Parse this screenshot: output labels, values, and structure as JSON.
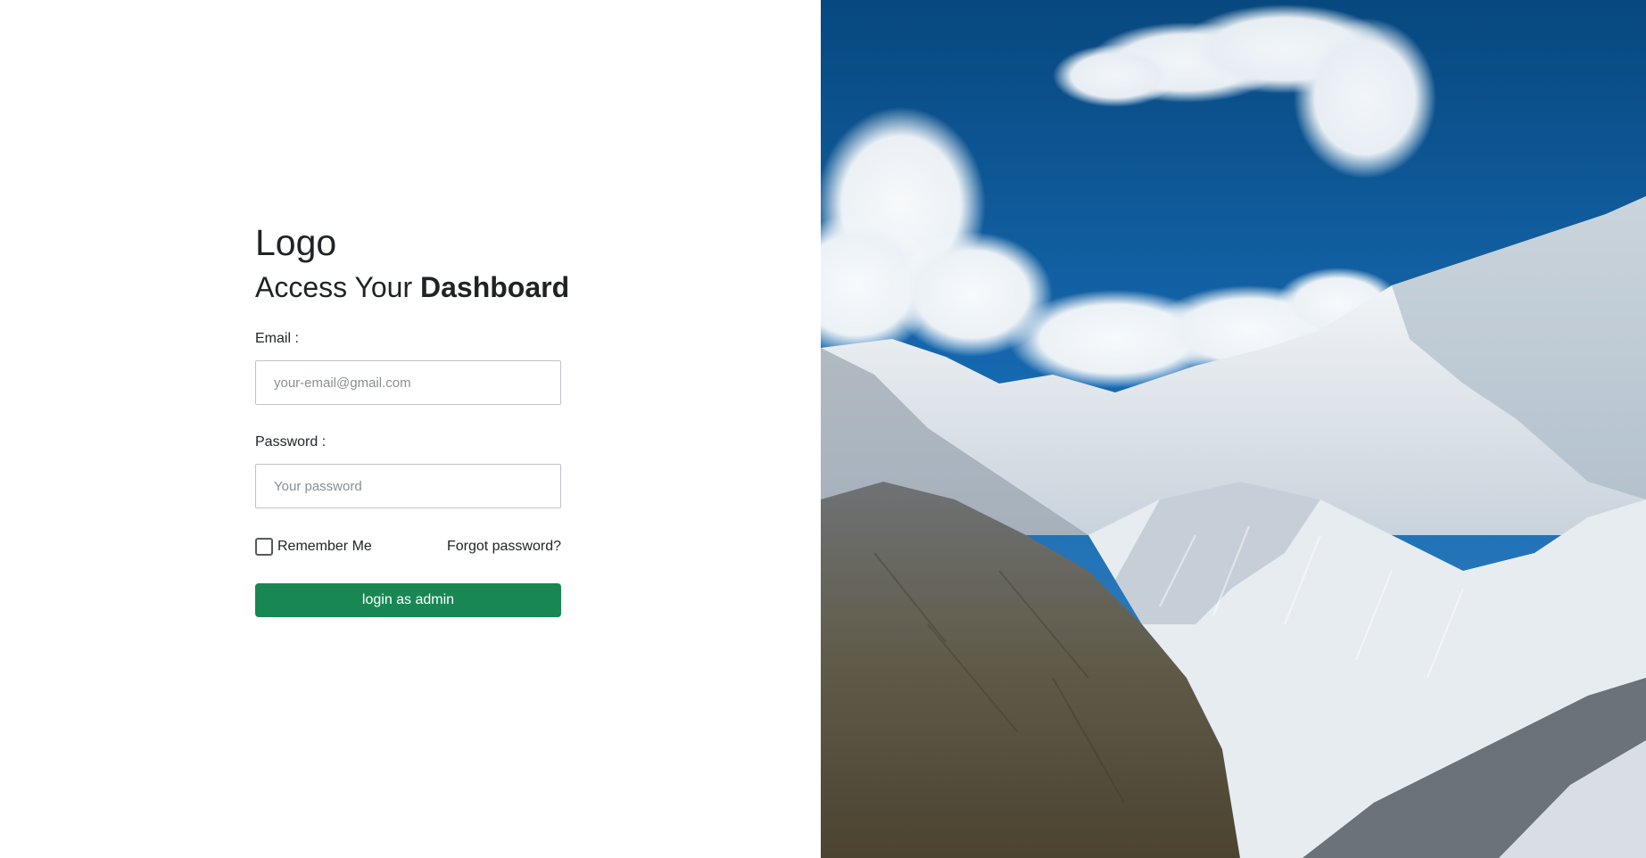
{
  "brand": {
    "logo_text": "Logo"
  },
  "heading": {
    "prefix": "Access Your ",
    "emphasis": "Dashboard"
  },
  "form": {
    "email_label": "Email :",
    "email_placeholder": "your-email@gmail.com",
    "email_value": "",
    "password_label": "Password :",
    "password_placeholder": "Your password",
    "password_value": "",
    "remember_label": "Remember Me",
    "remember_checked": false,
    "forgot_label": "Forgot password?",
    "submit_label": "login as admin"
  },
  "colors": {
    "primary_button": "#198754",
    "input_border": "#bfc3c7",
    "text": "#212529"
  },
  "hero_image": {
    "subject": "mountain-landscape"
  }
}
